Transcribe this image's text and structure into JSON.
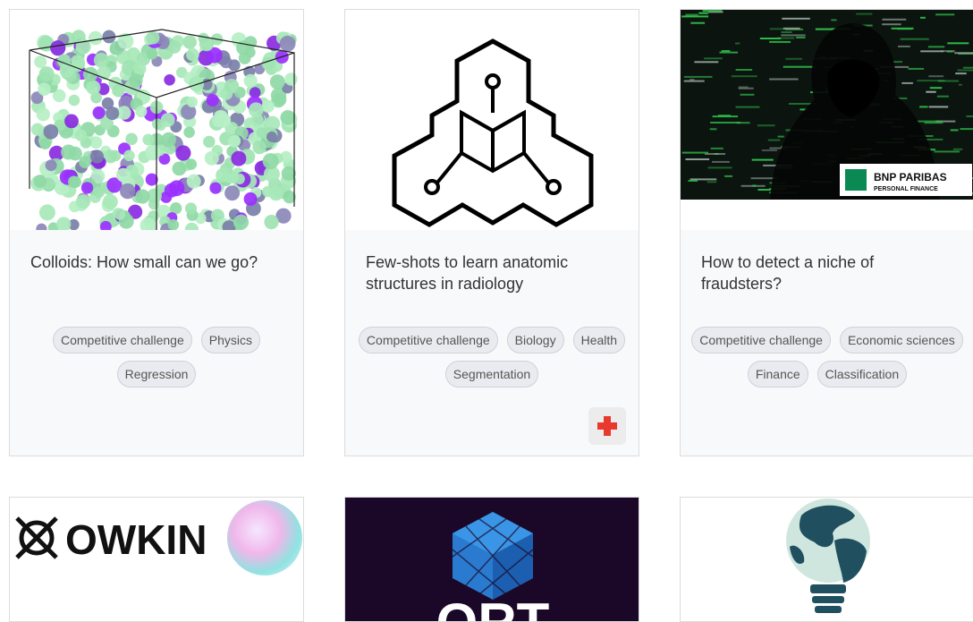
{
  "cards": [
    {
      "title": "Colloids: How small can we go?",
      "tags": [
        "Competitive challenge",
        "Physics",
        "Regression"
      ]
    },
    {
      "title": "Few-shots to learn anatomic structures in radiology",
      "tags": [
        "Competitive challenge",
        "Biology",
        "Health",
        "Segmentation"
      ]
    },
    {
      "title": "How to detect a niche of fraudsters?",
      "tags": [
        "Competitive challenge",
        "Economic sciences",
        "Finance",
        "Classification"
      ],
      "logo": {
        "line1": "BNP PARIBAS",
        "line2": "PERSONAL FINANCE"
      }
    },
    {
      "logo_text": "OWKIN"
    },
    {
      "logo_text": "QRT"
    },
    {}
  ],
  "colors": {
    "card_bg": "#f8f9fb",
    "tag_bg": "#eaebf0",
    "health_cross": "#e8392f"
  }
}
